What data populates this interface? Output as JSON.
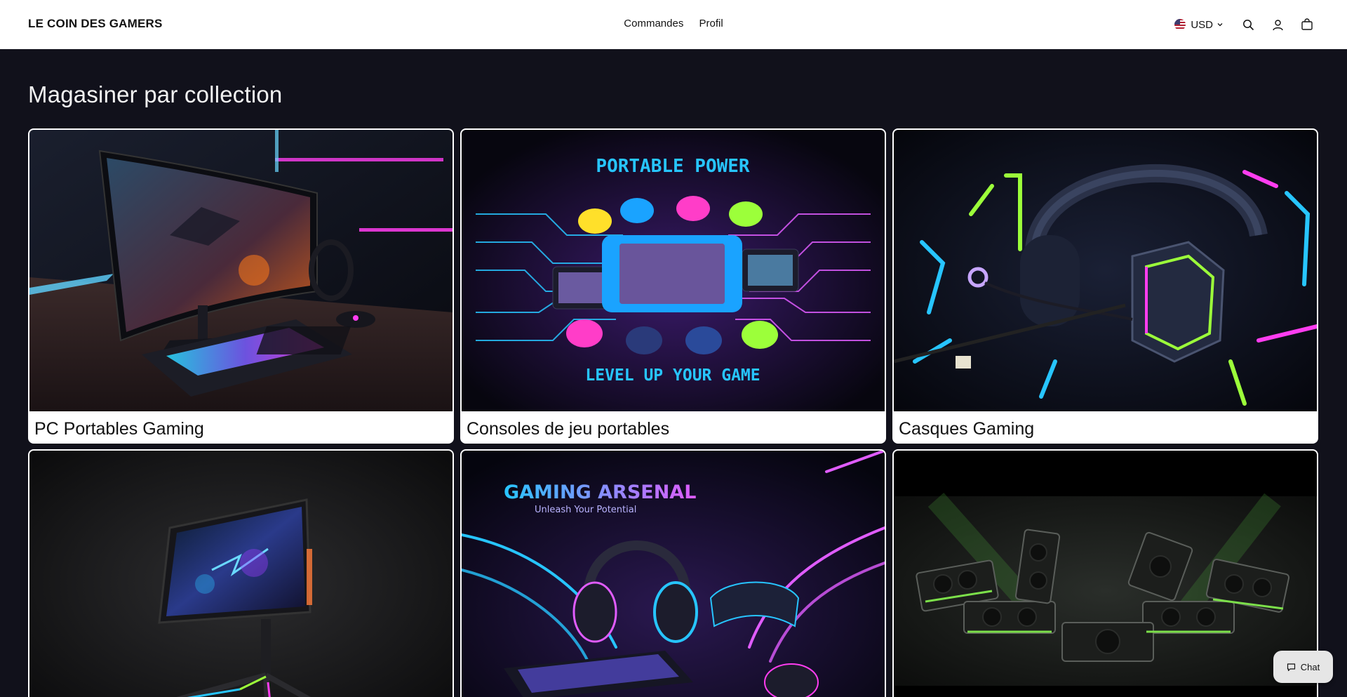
{
  "header": {
    "brand": "LE COIN DES GAMERS",
    "nav": [
      {
        "label": "Commandes"
      },
      {
        "label": "Profil"
      }
    ],
    "currency": "USD"
  },
  "main": {
    "heading": "Magasiner par collection",
    "collections": [
      {
        "label": "PC Portables Gaming",
        "image_text": []
      },
      {
        "label": "Consoles de jeu portables",
        "image_text": [
          "PORTABLE POWER",
          "LEVEL UP YOUR GAME"
        ]
      },
      {
        "label": "Casques Gaming",
        "image_text": []
      },
      {
        "label": "",
        "image_text": []
      },
      {
        "label": "",
        "image_text": [
          "GAMING ARSENAL",
          "Unleash Your Potential"
        ]
      },
      {
        "label": "",
        "image_text": []
      }
    ]
  },
  "chat": {
    "label": "Chat"
  },
  "colors": {
    "background": "#11111b",
    "header": "#ffffff",
    "neon_pink": "#ff3df0",
    "neon_cyan": "#27c5ff",
    "neon_green": "#9cff3a"
  }
}
